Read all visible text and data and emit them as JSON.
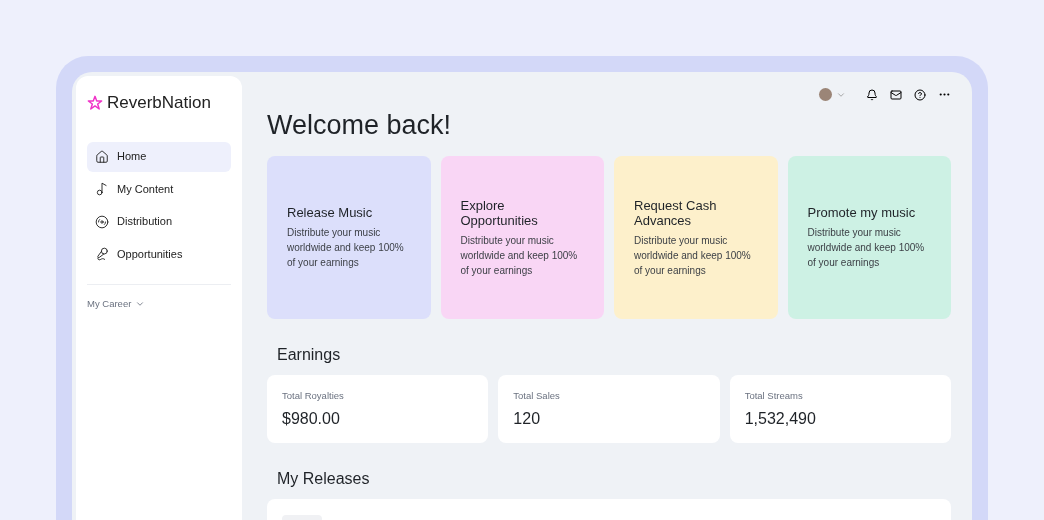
{
  "sidebar": {
    "logo": "ReverbNation",
    "items": [
      {
        "label": "Home",
        "selected": true
      },
      {
        "label": "My Content",
        "selected": false
      },
      {
        "label": "Distribution",
        "selected": false
      },
      {
        "label": "Opportunities",
        "selected": false
      }
    ],
    "section": "My Career"
  },
  "heading": "Welcome back!",
  "cards": [
    {
      "title": "Release Music",
      "text": "Distribute your music worldwide and keep 100% of your earnings",
      "color": "#dcdffb"
    },
    {
      "title": "Explore Opportunities",
      "text": "Distribute your music worldwide and keep 100% of your earnings",
      "color": "#f9d6f5"
    },
    {
      "title": "Request Cash Advances",
      "text": "Distribute your music worldwide and keep 100% of your earnings",
      "color": "#fdf0cb"
    },
    {
      "title": "Promote my music",
      "text": "Distribute your music worldwide and keep 100% of your earnings",
      "color": "#cdf1e4"
    }
  ],
  "earnings": {
    "title": "Earnings",
    "stats": [
      {
        "label": "Total Royalties",
        "value": "$980.00"
      },
      {
        "label": "Total Sales",
        "value": "120"
      },
      {
        "label": "Total Streams",
        "value": "1,532,490"
      }
    ]
  },
  "releases": {
    "title": "My Releases"
  }
}
